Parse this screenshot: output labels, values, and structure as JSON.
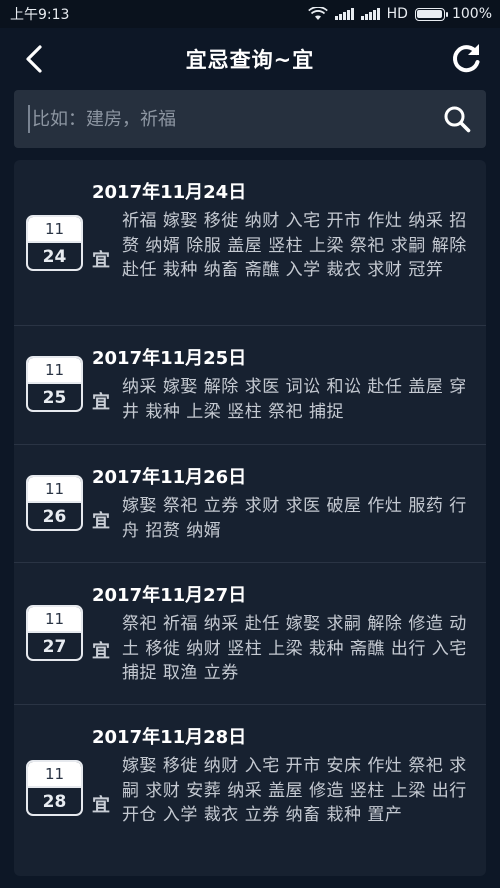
{
  "status_bar": {
    "time": "上午9:13",
    "network": "HD",
    "battery_percent": "100%",
    "battery_level": 1.0
  },
  "header": {
    "title": "宜忌查询~宜",
    "back_icon": "chevron-left-icon",
    "refresh_icon": "refresh-icon"
  },
  "search": {
    "placeholder": "比如：建房，祈福",
    "value": "",
    "icon": "search-icon"
  },
  "items": [
    {
      "date": "2017年11月24日",
      "month": "11",
      "day": "24",
      "label": "宜",
      "activities": "祈福 嫁娶 移徙 纳财 入宅 开市 作灶 纳采 招赘 纳婿 除服 盖屋 竖柱 上梁 祭祀 求嗣 解除 赴任 栽种 纳畜 斋醮 入学 裁衣 求财 冠笄"
    },
    {
      "date": "2017年11月25日",
      "month": "11",
      "day": "25",
      "label": "宜",
      "activities": "纳采 嫁娶 解除 求医 词讼 和讼 赴任 盖屋 穿井 栽种 上梁 竖柱 祭祀 捕捉"
    },
    {
      "date": "2017年11月26日",
      "month": "11",
      "day": "26",
      "label": "宜",
      "activities": "嫁娶 祭祀 立券 求财 求医 破屋 作灶 服药 行舟 招赘 纳婿"
    },
    {
      "date": "2017年11月27日",
      "month": "11",
      "day": "27",
      "label": "宜",
      "activities": "祭祀 祈福 纳采 赴任 嫁娶 求嗣 解除 修造 动土 移徙 纳财 竖柱 上梁 栽种 斋醮 出行 入宅 捕捉 取渔 立券"
    },
    {
      "date": "2017年11月28日",
      "month": "11",
      "day": "28",
      "label": "宜",
      "activities": "嫁娶 移徙 纳财 入宅 开市 安床 作灶 祭祀 求嗣 求财 安葬 纳采 盖屋 修造 竖柱 上梁 出行 开仓 入学 裁衣 立券 纳畜 栽种 置产"
    }
  ]
}
